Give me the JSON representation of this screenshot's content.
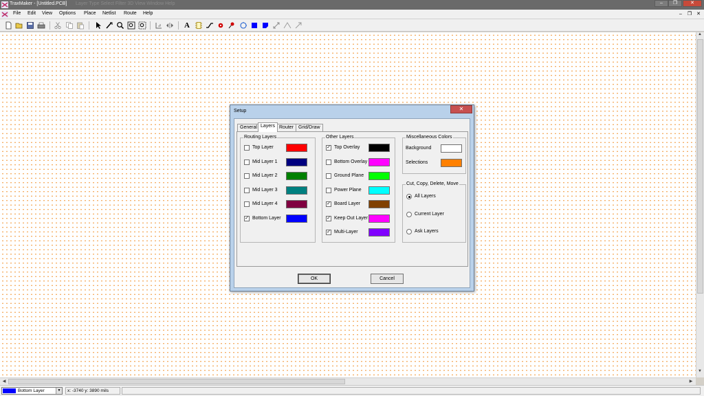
{
  "window": {
    "title": "TraxMaker - [Untitled.PCB]",
    "ghost_menu": "Layer    Type    Select    Filter    3D    View    Window    Help"
  },
  "menu": [
    "File",
    "Edit",
    "View",
    "Options",
    "Place",
    "Netlist",
    "Route",
    "Help"
  ],
  "dialog": {
    "title": "Setup",
    "tabs": [
      "General",
      "Layers",
      "Router",
      "Grid/Draw"
    ],
    "active_tab": "Layers",
    "routing_layers": {
      "title": "Routing Layers",
      "items": [
        {
          "label": "Top Layer",
          "checked": false,
          "color": "#ff0000"
        },
        {
          "label": "Mid Layer 1",
          "checked": false,
          "color": "#00007f"
        },
        {
          "label": "Mid Layer 2",
          "checked": false,
          "color": "#008000"
        },
        {
          "label": "Mid Layer 3",
          "checked": false,
          "color": "#008080"
        },
        {
          "label": "Mid Layer 4",
          "checked": false,
          "color": "#800040"
        },
        {
          "label": "Bottom Layer",
          "checked": true,
          "color": "#0000ff"
        }
      ]
    },
    "other_layers": {
      "title": "Other Layers",
      "items": [
        {
          "label": "Top Overlay",
          "checked": true,
          "color": "#000000"
        },
        {
          "label": "Bottom Overlay",
          "checked": false,
          "color": "#ff00ff"
        },
        {
          "label": "Ground Plane",
          "checked": false,
          "color": "#00ff00"
        },
        {
          "label": "Power Plane",
          "checked": false,
          "color": "#00ffff"
        },
        {
          "label": "Board Layer",
          "checked": true,
          "color": "#804000"
        },
        {
          "label": "Keep Out Layer",
          "checked": true,
          "color": "#ff00ff"
        },
        {
          "label": "Multi-Layer",
          "checked": true,
          "color": "#8000ff"
        }
      ]
    },
    "misc_colors": {
      "title": "Miscellaneous Colors",
      "items": [
        {
          "label": "Background",
          "color": "#ffffff"
        },
        {
          "label": "Selections",
          "color": "#ff8000"
        }
      ]
    },
    "cut_copy": {
      "title": "Cut, Copy, Delete, Move",
      "options": [
        {
          "label": "All Layers",
          "selected": true
        },
        {
          "label": "Current Layer",
          "selected": false
        },
        {
          "label": "Ask Layers",
          "selected": false
        }
      ]
    },
    "ok_label": "OK",
    "cancel_label": "Cancel"
  },
  "status": {
    "layer_label": "Bottom Layer",
    "layer_color": "#0000ff",
    "coords": "x: -3740  y: 3890   mils"
  },
  "icons": [
    "new-icon",
    "open-icon",
    "save-icon",
    "print-icon",
    "cut-icon",
    "copy-icon",
    "paste-icon",
    "select-arrow-icon",
    "route-icon",
    "zoom-icon",
    "zoom-area-icon",
    "zoom-fit-icon",
    "text-icon",
    "component-icon",
    "track-icon",
    "pad-icon",
    "via-icon",
    "arc-icon",
    "fill-icon",
    "polygon-icon"
  ]
}
